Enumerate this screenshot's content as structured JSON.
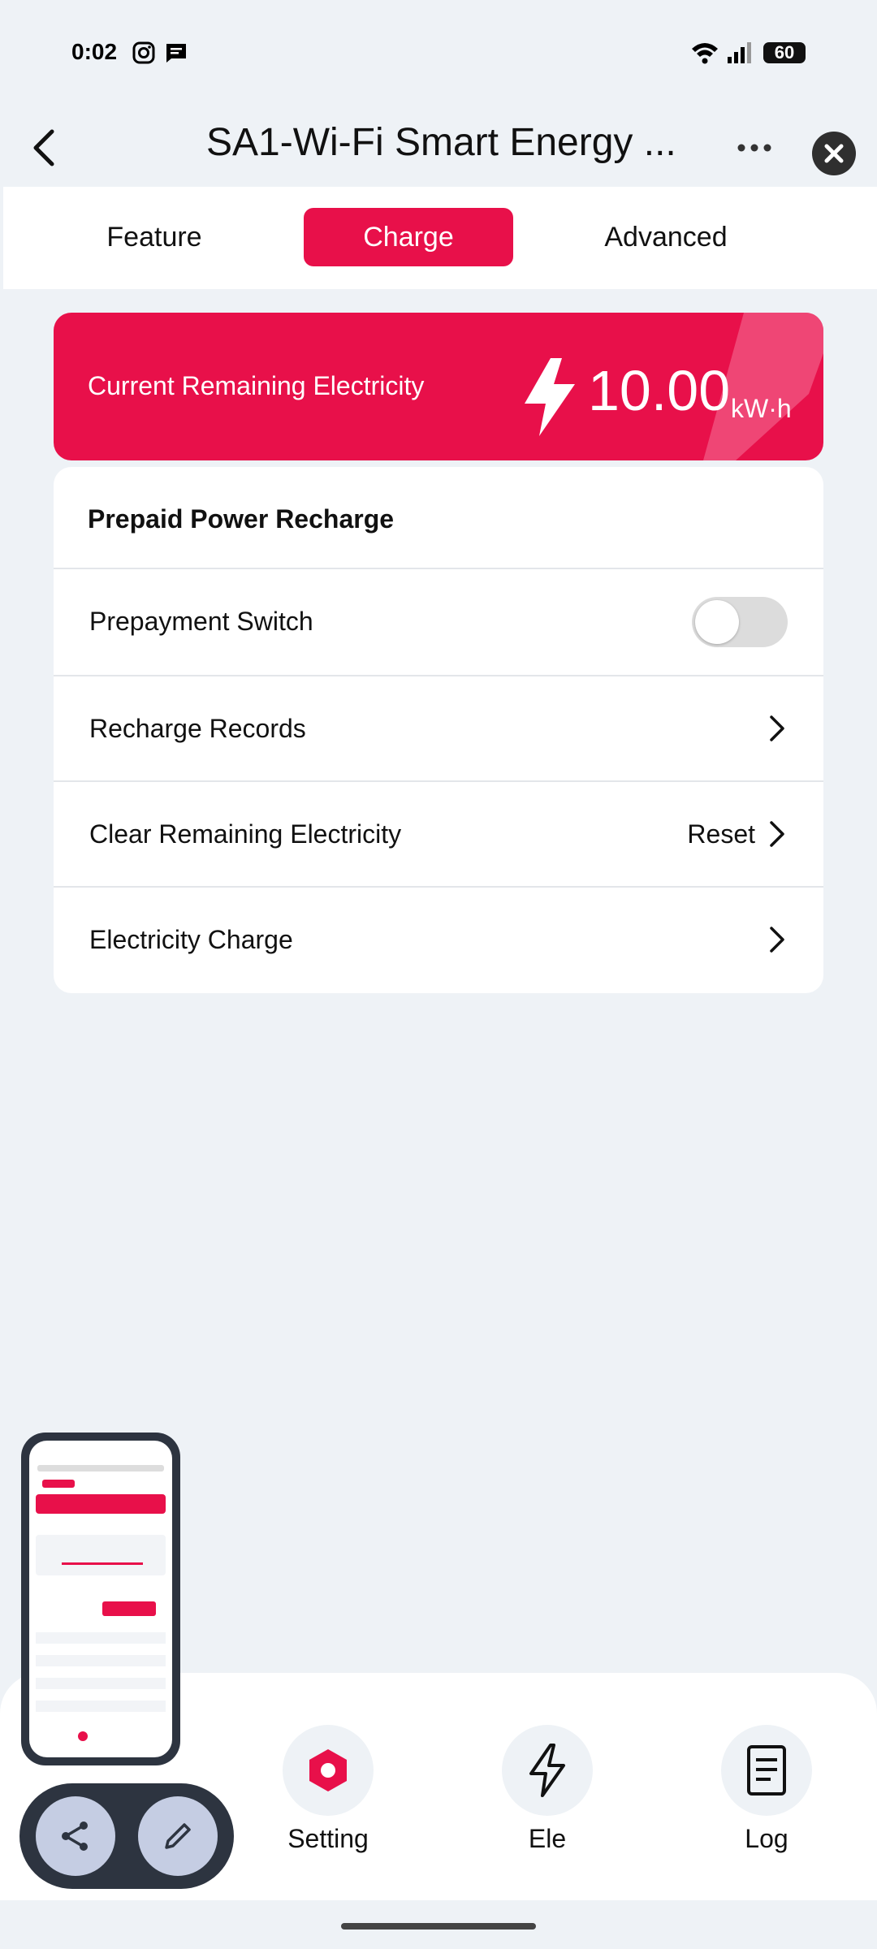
{
  "status_bar": {
    "time": "0:02",
    "battery": "60"
  },
  "header": {
    "title": "SA1-Wi-Fi Smart Energy ..."
  },
  "tabs": [
    {
      "label": "Feature",
      "active": false
    },
    {
      "label": "Charge",
      "active": true
    },
    {
      "label": "Advanced",
      "active": false
    }
  ],
  "banner": {
    "label": "Current Remaining Electricity",
    "value": "10.00",
    "unit": "kW·h"
  },
  "card": {
    "heading": "Prepaid Power Recharge",
    "rows": [
      {
        "label": "Prepayment Switch",
        "toggle_on": false
      },
      {
        "label": "Recharge Records"
      },
      {
        "label": "Clear Remaining Electricity",
        "value": "Reset"
      },
      {
        "label": "Electricity Charge"
      }
    ]
  },
  "bottom_nav": [
    {
      "label": "Setting",
      "icon": "hexagon-setting-icon",
      "active": true
    },
    {
      "label": "Ele",
      "icon": "lightning-icon"
    },
    {
      "label": "Log",
      "icon": "document-icon"
    }
  ],
  "colors": {
    "accent": "#e8104a",
    "background": "#eef2f6"
  }
}
